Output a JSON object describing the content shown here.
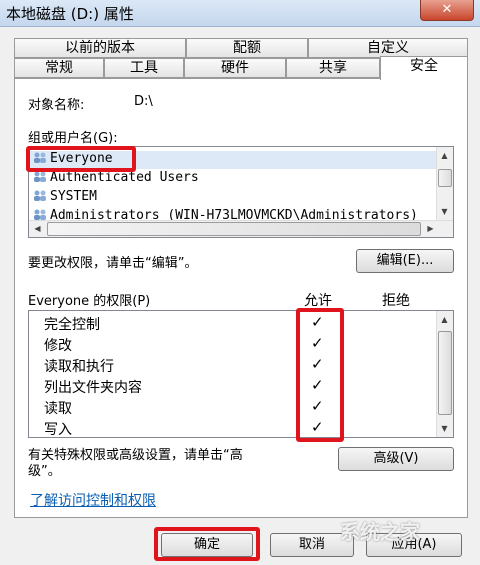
{
  "window": {
    "title": "本地磁盘 (D:) 属性",
    "close_glyph": "✕"
  },
  "tabs_top": [
    "以前的版本",
    "配额",
    "自定义"
  ],
  "tabs_bottom": [
    "常规",
    "工具",
    "硬件",
    "共享",
    "安全"
  ],
  "selected_tab": "安全",
  "object": {
    "label": "对象名称:",
    "value": "D:\\"
  },
  "groups": {
    "label": "组或用户名(G):",
    "users": [
      "Everyone",
      "Authenticated Users",
      "SYSTEM",
      "Administrators (WIN-H73LMOVMCKD\\Administrators)"
    ],
    "selected_user": "Everyone"
  },
  "edit": {
    "hint": "要更改权限，请单击“编辑”。",
    "button_label": "编辑(E)..."
  },
  "permissions": {
    "title": "Everyone 的权限(P)",
    "allow_header": "允许",
    "deny_header": "拒绝",
    "items": [
      "完全控制",
      "修改",
      "读取和执行",
      "列出文件夹内容",
      "读取",
      "写入"
    ],
    "allow_mark": "✓",
    "allowed": [
      true,
      true,
      true,
      true,
      true,
      true
    ],
    "denied": [
      false,
      false,
      false,
      false,
      false,
      false
    ]
  },
  "advanced": {
    "hint_line1": "有关特殊权限或高级设置，请单击“高",
    "hint_line2": "级”。",
    "button_label": "高级(V)"
  },
  "link_text": "了解访问控制和权限",
  "footer": {
    "ok_label": "确定",
    "cancel_label": "取消",
    "apply_label": "应用(A)"
  },
  "watermark": "系统之家",
  "colors": {
    "highlight": "#e0141c",
    "link": "#0a5fb4"
  }
}
